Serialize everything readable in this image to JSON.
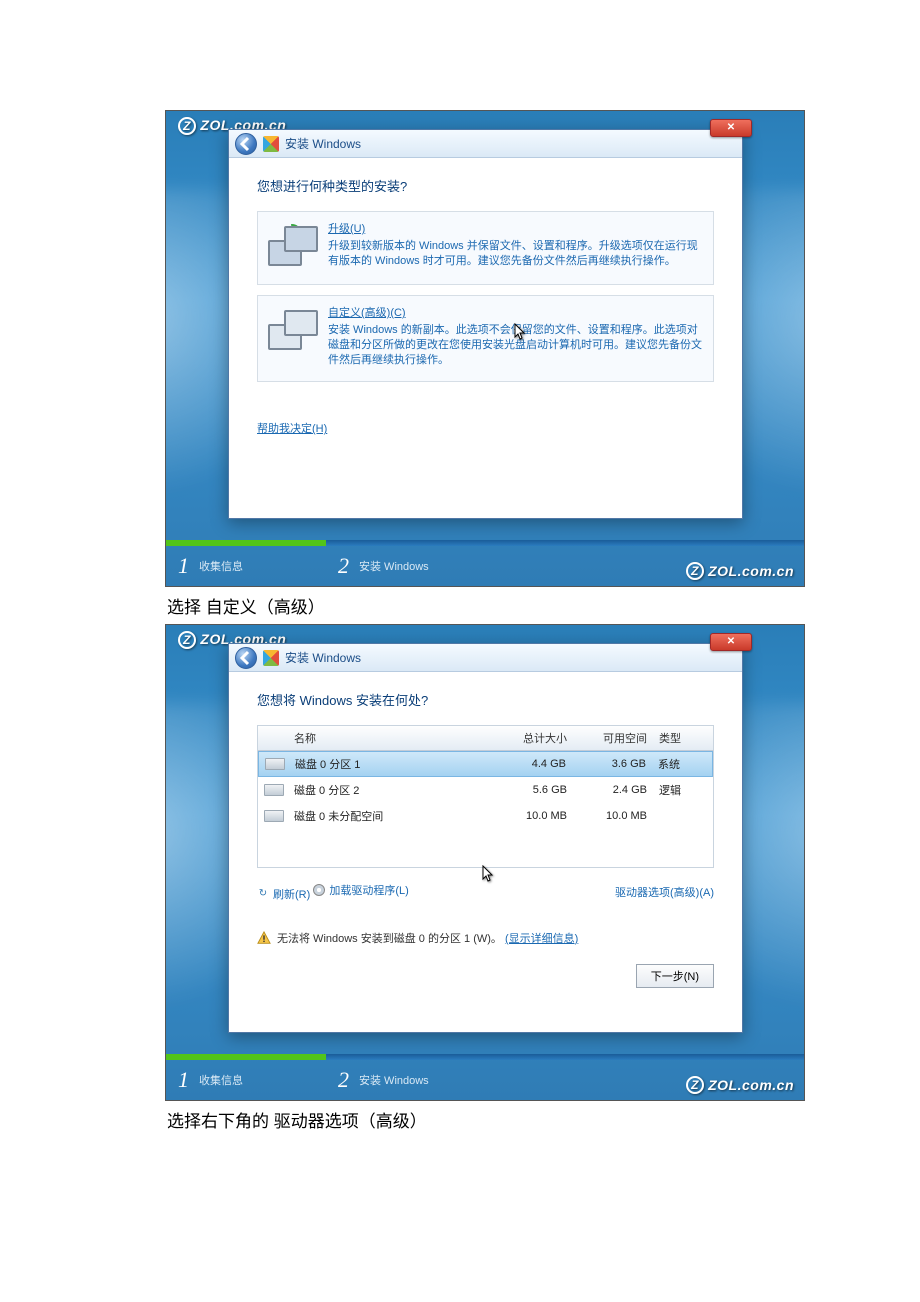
{
  "watermark": "ZOL.com.cn",
  "caption1": "选择  自定义（高级）",
  "caption2": "选择右下角的  驱动器选项（高级）",
  "shared": {
    "dialog_title": "安装 Windows",
    "close_x": "✕",
    "progress_step1": "收集信息",
    "progress_step2": "安装 Windows"
  },
  "screen1": {
    "heading": "您想进行何种类型的安装?",
    "upgrade": {
      "title": "升级(U)",
      "desc": "升级到较新版本的 Windows 并保留文件、设置和程序。升级选项仅在运行现有版本的 Windows 时才可用。建议您先备份文件然后再继续执行操作。"
    },
    "custom": {
      "title": "自定义(高级)(C)",
      "desc": "安装 Windows 的新副本。此选项不会保留您的文件、设置和程序。此选项对磁盘和分区所做的更改在您使用安装光盘启动计算机时可用。建议您先备份文件然后再继续执行操作。"
    },
    "help_link": "帮助我决定(H)"
  },
  "screen2": {
    "heading": "您想将 Windows 安装在何处?",
    "columns": {
      "name": "名称",
      "total": "总计大小",
      "free": "可用空间",
      "type": "类型"
    },
    "rows": [
      {
        "name": "磁盘 0 分区 1",
        "total": "4.4 GB",
        "free": "3.6 GB",
        "type": "系统",
        "selected": true
      },
      {
        "name": "磁盘 0 分区 2",
        "total": "5.6 GB",
        "free": "2.4 GB",
        "type": "逻辑",
        "selected": false
      },
      {
        "name": "磁盘 0 未分配空间",
        "total": "10.0 MB",
        "free": "10.0 MB",
        "type": "",
        "selected": false
      }
    ],
    "refresh": "刷新(R)",
    "load_driver": "加载驱动程序(L)",
    "drive_options": "驱动器选项(高级)(A)",
    "warning_prefix": "无法将 Windows 安装到磁盘 0 的分区 1 (W)。",
    "warning_link": "(显示详细信息)",
    "next_button": "下一步(N)"
  }
}
